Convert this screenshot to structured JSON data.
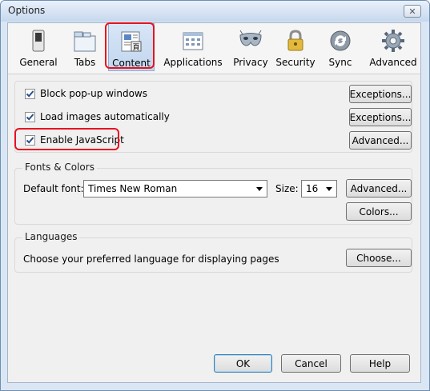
{
  "window": {
    "title": "Options"
  },
  "tabs": [
    {
      "id": "general",
      "label": "General"
    },
    {
      "id": "tabs",
      "label": "Tabs"
    },
    {
      "id": "content",
      "label": "Content"
    },
    {
      "id": "applications",
      "label": "Applications"
    },
    {
      "id": "privacy",
      "label": "Privacy"
    },
    {
      "id": "security",
      "label": "Security"
    },
    {
      "id": "sync",
      "label": "Sync"
    },
    {
      "id": "advanced",
      "label": "Advanced"
    }
  ],
  "selected_tab": "content",
  "content": {
    "block_popups": {
      "label": "Block pop-up windows",
      "checked": true
    },
    "load_images": {
      "label": "Load images automatically",
      "checked": true
    },
    "enable_js": {
      "label": "Enable JavaScript",
      "checked": true
    },
    "exceptions_label": "Exceptions...",
    "advanced_label": "Advanced..."
  },
  "fonts": {
    "group_title": "Fonts & Colors",
    "default_font_label": "Default font:",
    "default_font_value": "Times New Roman",
    "size_label": "Size:",
    "size_value": "16",
    "advanced_label": "Advanced...",
    "colors_label": "Colors..."
  },
  "languages": {
    "group_title": "Languages",
    "description": "Choose your preferred language for displaying pages",
    "choose_label": "Choose..."
  },
  "footer": {
    "ok_label": "OK",
    "cancel_label": "Cancel",
    "help_label": "Help"
  },
  "colors": {
    "highlight": "#e8111f",
    "title_bar": "#c6d8ee",
    "dialog_bg": "#f0f0f0"
  }
}
